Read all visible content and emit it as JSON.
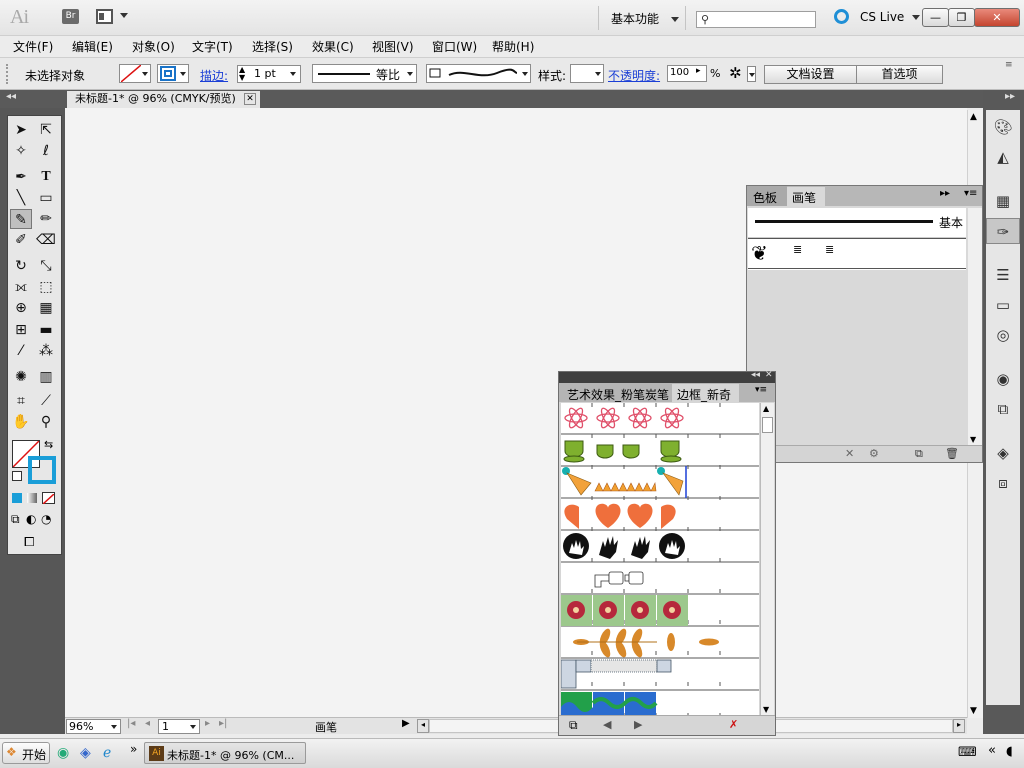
{
  "titlebar": {
    "app_logo": "Ai",
    "bridge_button": "Br",
    "workspace": "基本功能",
    "search_placeholder": "",
    "cs_live": "CS Live",
    "minimize": "—",
    "restore": "❐",
    "close": "✕"
  },
  "menu": [
    "文件(F)",
    "编辑(E)",
    "对象(O)",
    "文字(T)",
    "选择(S)",
    "效果(C)",
    "视图(V)",
    "窗口(W)",
    "帮助(H)"
  ],
  "control": {
    "selection_state": "未选择对象",
    "stroke_label": "描边:",
    "stroke_weight": "1 pt",
    "stroke_profile": "等比",
    "style_label": "样式:",
    "opacity_label": "不透明度:",
    "opacity_value": "100",
    "opacity_unit": "%",
    "doc_setup_button": "文档设置",
    "preferences_button": "首选项"
  },
  "document": {
    "tab_title": "未标题-1* @ 96% (CMYK/预览)",
    "zoom": "96%",
    "artboard": "1",
    "status": "画笔"
  },
  "brush_panel": {
    "tabs": [
      "色板",
      "画笔"
    ],
    "active_tab": "画笔",
    "basic_brush_label": "基本"
  },
  "border_panel": {
    "tabs": [
      "艺术效果_粉笔炭笔",
      "边框_新奇"
    ],
    "active_tab": "边框_新奇",
    "rows": [
      "atoms",
      "cups",
      "party-hats",
      "hearts",
      "hands",
      "pointing-hands",
      "flowers",
      "leaves",
      "ui-tiles",
      "waves"
    ]
  },
  "taskbar": {
    "start": "开始",
    "task": "未标题-1* @ 96% (CM...",
    "more": "»"
  },
  "colors": {
    "accent": "#1f8fd6",
    "dock": "#575757",
    "close_red": "#c4452f"
  }
}
